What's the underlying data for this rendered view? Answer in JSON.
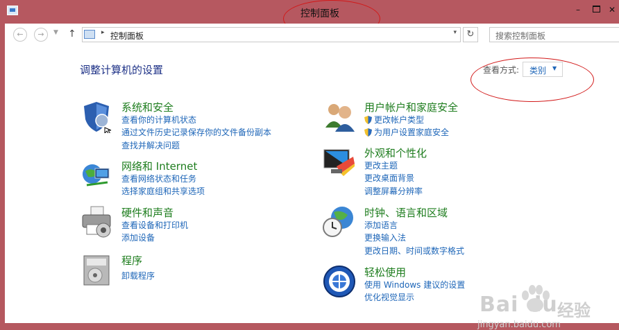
{
  "window": {
    "title": "控制面板",
    "minimize": "–",
    "close": "✕"
  },
  "nav": {
    "back": "←",
    "forward": "→",
    "recent": "▼",
    "up": "↑",
    "address_separator": "▸",
    "address": "控制面板",
    "address_dropdown": "▾",
    "refresh": "↻",
    "search_placeholder": "搜索控制面板"
  },
  "heading": "调整计算机的设置",
  "view": {
    "label": "查看方式:",
    "value": "类别",
    "caret": "▼"
  },
  "categories_left": [
    {
      "icon": "shield-security-icon",
      "title": "系统和安全",
      "links": [
        "查看你的计算机状态",
        "通过文件历史记录保存你的文件备份副本",
        "查找并解决问题"
      ]
    },
    {
      "icon": "network-globe-icon",
      "title": "网络和 Internet",
      "links": [
        "查看网络状态和任务",
        "选择家庭组和共享选项"
      ]
    },
    {
      "icon": "printer-icon",
      "title": "硬件和声音",
      "links": [
        "查看设备和打印机",
        "添加设备"
      ]
    },
    {
      "icon": "programs-box-icon",
      "title": "程序",
      "links": [
        "卸载程序"
      ]
    }
  ],
  "categories_right": [
    {
      "icon": "users-icon",
      "title": "用户帐户和家庭安全",
      "links": [
        "更改帐户类型",
        "为用户设置家庭安全"
      ]
    },
    {
      "icon": "monitor-palette-icon",
      "title": "外观和个性化",
      "links": [
        "更改主题",
        "更改桌面背景",
        "调整屏幕分辨率"
      ]
    },
    {
      "icon": "clock-globe-icon",
      "title": "时钟、语言和区域",
      "links": [
        "添加语言",
        "更换输入法",
        "更改日期、时间或数字格式"
      ]
    },
    {
      "icon": "ease-of-access-icon",
      "title": "轻松使用",
      "links": [
        "使用 Windows 建议的设置",
        "优化视觉显示"
      ]
    }
  ],
  "watermark": {
    "logo": "Bai du",
    "cn": "经验",
    "url": "jingyan.baidu.com"
  },
  "colors": {
    "titlebar": "#b65860",
    "category_title": "#1e7d1e",
    "link": "#1e66b8",
    "heading": "#1e3287",
    "annotation": "#d21919"
  }
}
